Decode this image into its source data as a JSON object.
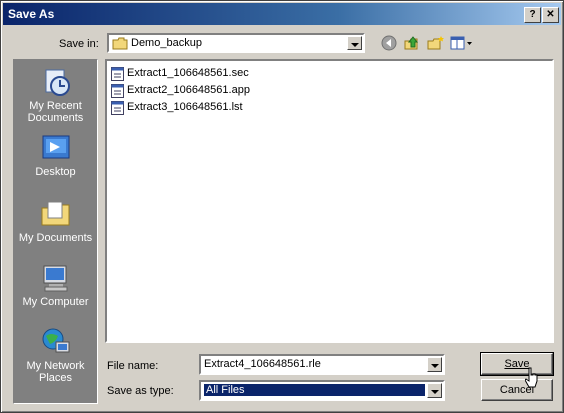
{
  "title": "Save As",
  "titlebar": {
    "help": "?",
    "close": "✕"
  },
  "save_in": {
    "label": "Save in:",
    "value": "Demo_backup"
  },
  "places": [
    {
      "label": "My Recent Documents",
      "icon": "recent-documents-icon"
    },
    {
      "label": "Desktop",
      "icon": "desktop-icon"
    },
    {
      "label": "My Documents",
      "icon": "my-documents-icon"
    },
    {
      "label": "My Computer",
      "icon": "my-computer-icon"
    },
    {
      "label": "My Network Places",
      "icon": "network-places-icon"
    }
  ],
  "files": [
    "Extract1_106648561.sec",
    "Extract2_106648561.app",
    "Extract3_106648561.lst"
  ],
  "file_name": {
    "label": "File name:",
    "value": "Extract4_106648561.rle"
  },
  "save_as_type": {
    "label": "Save as type:",
    "value": "All Files"
  },
  "buttons": {
    "save": "Save",
    "cancel": "Cancel"
  }
}
